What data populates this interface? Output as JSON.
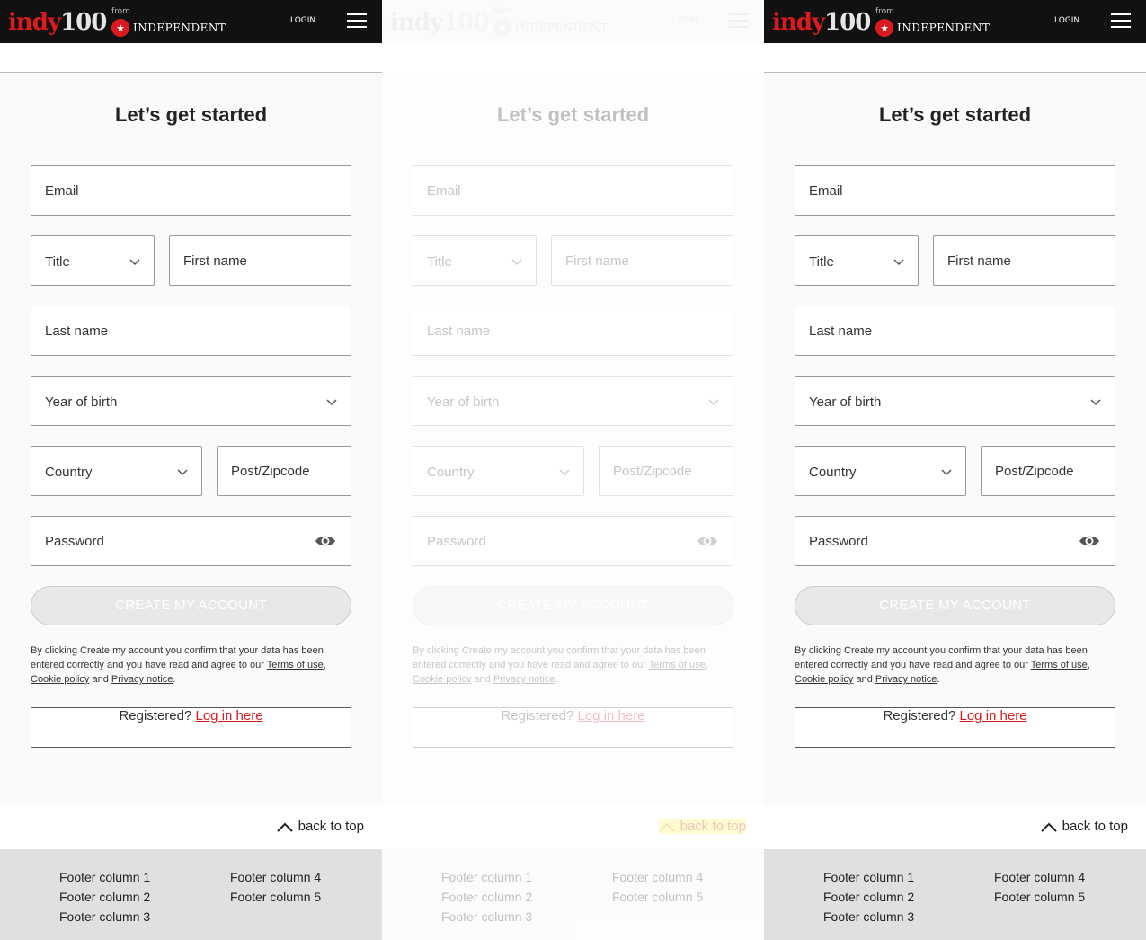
{
  "header": {
    "logo_text": "indy",
    "logo_number": "100",
    "from_label": "from",
    "publisher": "INDEPENDENT",
    "login_label": "LOGIN",
    "menu_icon": "hamburger-menu-icon"
  },
  "form": {
    "title": "Let’s get started",
    "email_placeholder": "Email",
    "title_select_label": "Title",
    "first_name_placeholder": "First name",
    "last_name_placeholder": "Last name",
    "year_of_birth_label": "Year of birth",
    "country_label": "Country",
    "postcode_placeholder": "Post/Zipcode",
    "password_placeholder": "Password",
    "create_button": "CREATE MY ACCOUNT",
    "terms_prefix": "By clicking Create my account you confirm that your data has been entered correctly and you have read and agree to our ",
    "terms_link": "Terms of use",
    "cookie_link": "Cookie policy",
    "and_text": "and",
    "privacy_link": "Privacy notice",
    "registered_text": "Registered?",
    "login_here_link": "Log in here"
  },
  "back_to_top": "back to top",
  "footer": {
    "col1": [
      "Footer column 1",
      "Footer column 2",
      "Footer column 3"
    ],
    "col2": [
      "Footer column 4",
      "Footer column 5"
    ]
  },
  "colors": {
    "brand_red": "#d91b1f",
    "header_bg": "#111111",
    "footer_bg": "#e0e0e0"
  }
}
